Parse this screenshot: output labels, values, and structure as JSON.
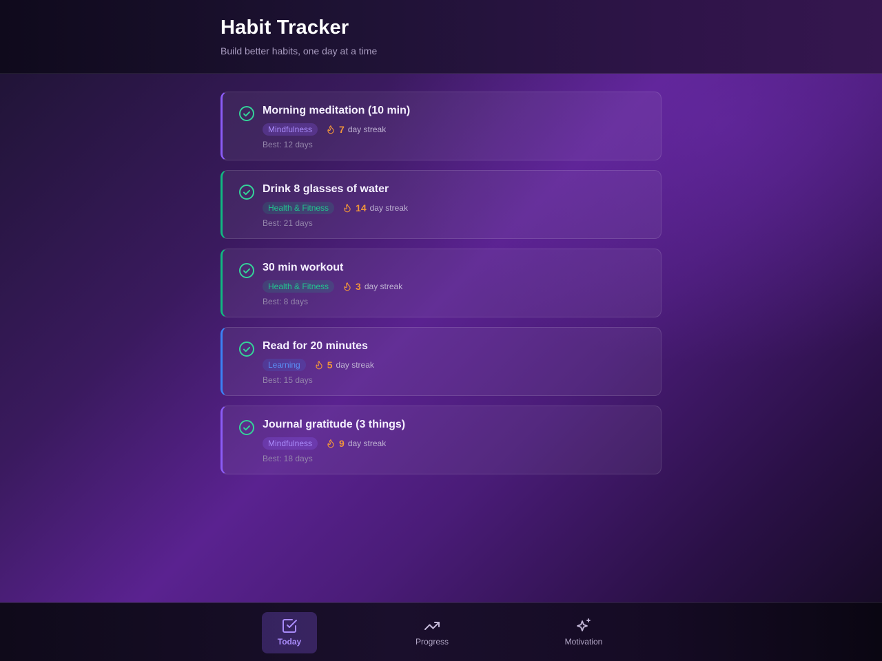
{
  "header": {
    "title": "Habit Tracker",
    "subtitle": "Build better habits, one day at a time"
  },
  "habits": [
    {
      "name": "Morning meditation (10 min)",
      "category": "Mindfulness",
      "category_color": "#8b5cf6",
      "streak_count": "7",
      "streak_label": "day streak",
      "best": "Best: 12 days",
      "completed": true
    },
    {
      "name": "Drink 8 glasses of water",
      "category": "Health & Fitness",
      "category_color": "#10b981",
      "streak_count": "14",
      "streak_label": "day streak",
      "best": "Best: 21 days",
      "completed": true
    },
    {
      "name": "30 min workout",
      "category": "Health & Fitness",
      "category_color": "#10b981",
      "streak_count": "3",
      "streak_label": "day streak",
      "best": "Best: 8 days",
      "completed": true
    },
    {
      "name": "Read for 20 minutes",
      "category": "Learning",
      "category_color": "#3b82f6",
      "streak_count": "5",
      "streak_label": "day streak",
      "best": "Best: 15 days",
      "completed": true
    },
    {
      "name": "Journal gratitude (3 things)",
      "category": "Mindfulness",
      "category_color": "#8b5cf6",
      "streak_count": "9",
      "streak_label": "day streak",
      "best": "Best: 18 days",
      "completed": true
    }
  ],
  "nav": {
    "items": [
      {
        "label": "Today",
        "icon": "checkbox-icon",
        "active": true
      },
      {
        "label": "Progress",
        "icon": "trending-up-icon",
        "active": false
      },
      {
        "label": "Motivation",
        "icon": "sparkles-icon",
        "active": false
      }
    ]
  },
  "colors": {
    "accent": "#8b5cf6",
    "check": "#34d399",
    "streak": "#f0953a"
  }
}
